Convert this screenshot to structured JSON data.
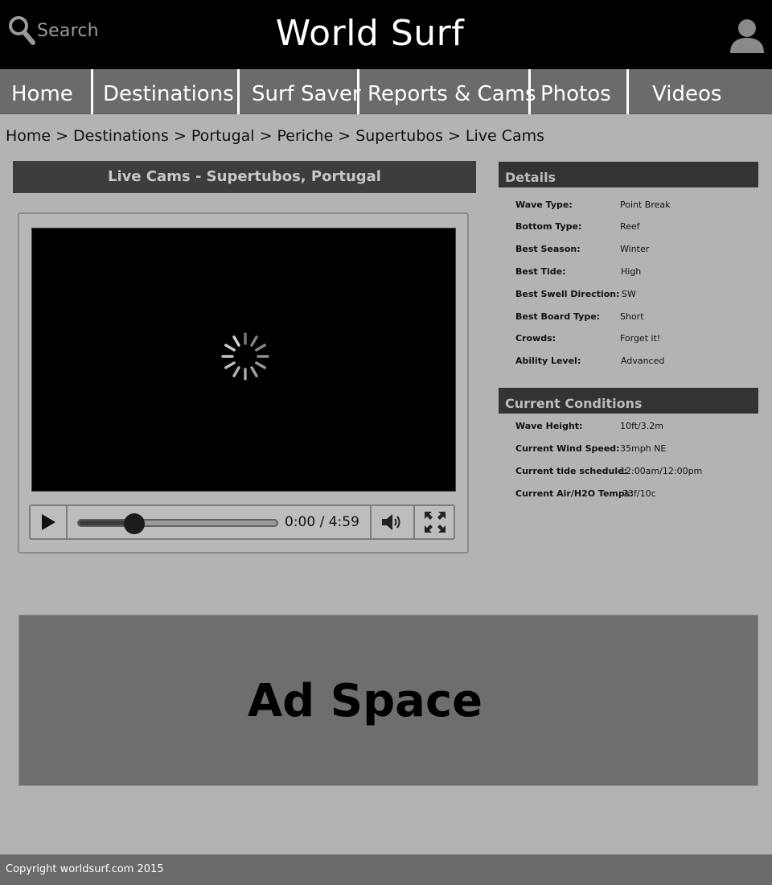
{
  "header": {
    "search_label": "Search",
    "site_title": "World Surf",
    "search_icon": "search-icon",
    "user_icon": "user-icon"
  },
  "nav": {
    "items": [
      {
        "label": "Home"
      },
      {
        "label": "Destinations"
      },
      {
        "label": "Surf Saver"
      },
      {
        "label": "Reports & Cams"
      },
      {
        "label": "Photos"
      },
      {
        "label": "Videos"
      }
    ]
  },
  "breadcrumb": {
    "items": [
      "Home",
      "Destinations",
      "Portugal",
      "Periche",
      "Supertubos",
      "Live Cams"
    ],
    "separator": ">"
  },
  "cam": {
    "title": "Live Cams - Supertubos, Portugal"
  },
  "player": {
    "state": "loading",
    "current_time": "0:00",
    "duration": "4:59",
    "time_display": "0:00 / 4:59",
    "progress_fraction": 0.28,
    "icons": [
      "play-icon",
      "loading-spinner-icon",
      "volume-icon",
      "fullscreen-icon"
    ]
  },
  "details": {
    "heading": "Details",
    "rows": [
      {
        "key": "Wave Type:",
        "value": "Point Break"
      },
      {
        "key": "Bottom Type:",
        "value": "Reef"
      },
      {
        "key": "Best Season:",
        "value": "Winter"
      },
      {
        "key": "Best Tide:",
        "value": "High"
      },
      {
        "key": "Best Swell Direction:",
        "value": "SW"
      },
      {
        "key": "Best Board Type:",
        "value": "Short"
      },
      {
        "key": "Crowds:",
        "value": "Forget it!"
      },
      {
        "key": "Ability Level:",
        "value": "Advanced"
      }
    ]
  },
  "conditions": {
    "heading": "Current Conditions",
    "rows": [
      {
        "key": "Wave Height:",
        "value": "10ft/3.2m"
      },
      {
        "key": "Current Wind Speed:",
        "value": "35mph NE"
      },
      {
        "key": "Current tide schedule:",
        "value": "12:00am/12:00pm"
      },
      {
        "key": "Current Air/H2O Temps:",
        "value": "73f/10c"
      }
    ]
  },
  "ad": {
    "label": "Ad Space"
  },
  "footer": {
    "copyright": "Copyright worldsurf.com 2015"
  },
  "colors": {
    "page_bg": "#b3b3b3",
    "header_bg": "#000000",
    "nav_bg": "#6b6b6b",
    "panel_head_bg": "#333333",
    "ad_bg": "#6f6e6e",
    "footer_bg": "#6a6a6a"
  }
}
